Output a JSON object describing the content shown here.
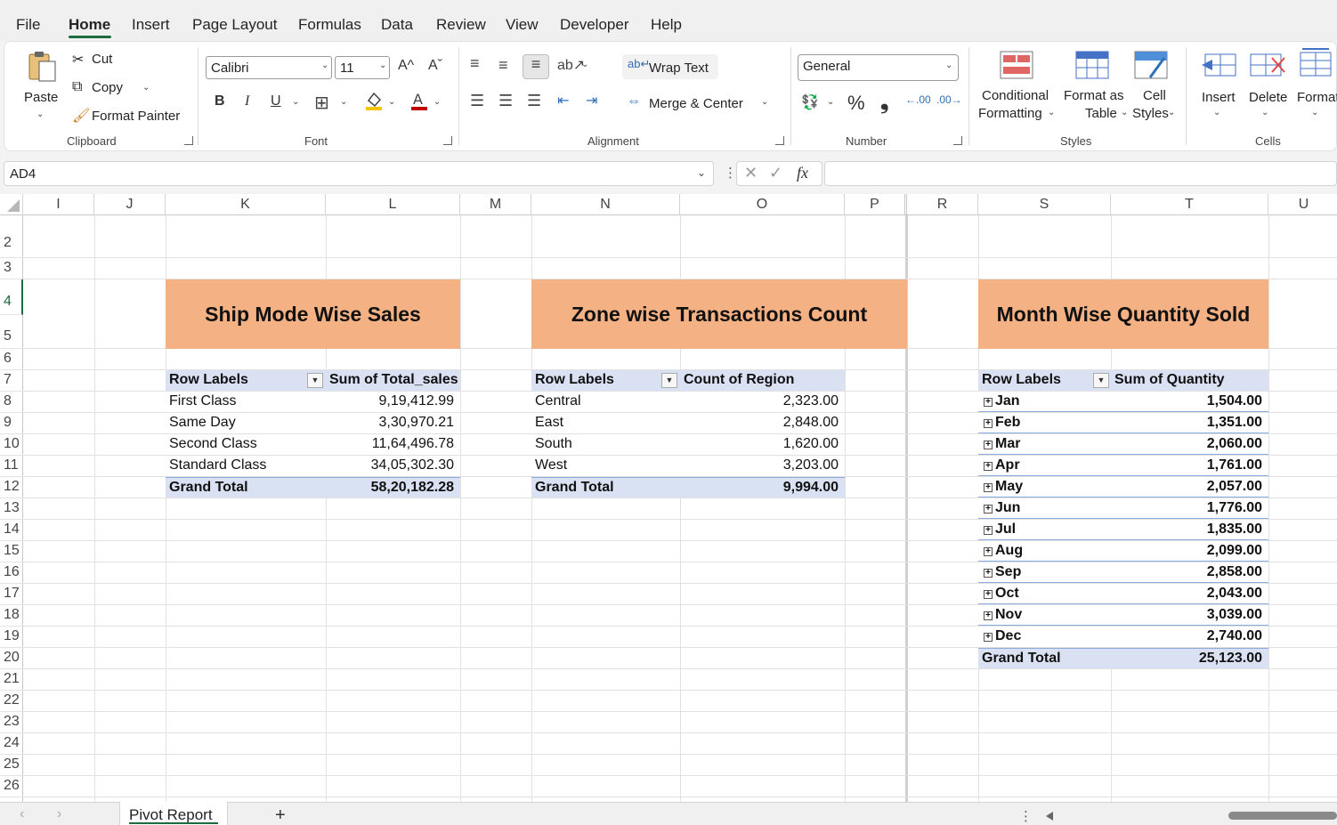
{
  "menu": [
    "File",
    "Home",
    "Insert",
    "Page Layout",
    "Formulas",
    "Data",
    "Review",
    "View",
    "Developer",
    "Help"
  ],
  "ribbon": {
    "clipboard": {
      "paste": "Paste",
      "cut": "Cut",
      "copy": "Copy",
      "format_painter": "Format Painter",
      "label": "Clipboard"
    },
    "font": {
      "name": "Calibri",
      "size": "11",
      "bold": "B",
      "italic": "I",
      "underline": "U",
      "grow": "A^",
      "shrink": "Aˇ",
      "label": "Font"
    },
    "alignment": {
      "wrap_text": "Wrap Text",
      "merge_center": "Merge & Center",
      "label": "Alignment"
    },
    "number": {
      "format": "General",
      "percent": "%",
      "comma": "❟",
      "label": "Number"
    },
    "styles": {
      "conditional_1": "Conditional",
      "conditional_2": "Formatting",
      "format_table_1": "Format as",
      "format_table_2": "Table",
      "cell_styles_1": "Cell",
      "cell_styles_2": "Styles",
      "label": "Styles"
    },
    "cells": {
      "insert": "Insert",
      "delete": "Delete",
      "format": "Format",
      "label": "Cells"
    }
  },
  "formula_bar": {
    "name_box": "AD4",
    "fx": "fx",
    "formula": ""
  },
  "columns": [
    "I",
    "J",
    "K",
    "L",
    "M",
    "N",
    "O",
    "P",
    "R",
    "S",
    "T",
    "U"
  ],
  "rows": [
    "2",
    "3",
    "4",
    "5",
    "6",
    "7",
    "8",
    "9",
    "10",
    "11",
    "12",
    "13",
    "14",
    "15",
    "16",
    "17",
    "18",
    "19",
    "20",
    "21",
    "22",
    "23",
    "24",
    "25",
    "26"
  ],
  "pivot1": {
    "title": "Ship Mode Wise Sales",
    "col1": "Row Labels",
    "col2": "Sum of Total_sales",
    "rows": [
      {
        "label": "First Class",
        "value": "9,19,412.99"
      },
      {
        "label": "Same Day",
        "value": "3,30,970.21"
      },
      {
        "label": "Second Class",
        "value": "11,64,496.78"
      },
      {
        "label": "Standard Class",
        "value": "34,05,302.30"
      }
    ],
    "total_label": "Grand Total",
    "total_value": "58,20,182.28"
  },
  "pivot2": {
    "title": "Zone wise Transactions Count",
    "col1": "Row Labels",
    "col2": "Count of Region",
    "rows": [
      {
        "label": "Central",
        "value": "2,323.00"
      },
      {
        "label": "East",
        "value": "2,848.00"
      },
      {
        "label": "South",
        "value": "1,620.00"
      },
      {
        "label": "West",
        "value": "3,203.00"
      }
    ],
    "total_label": "Grand Total",
    "total_value": "9,994.00"
  },
  "pivot3": {
    "title": "Month Wise Quantity Sold",
    "col1": "Row Labels",
    "col2": "Sum of Quantity",
    "rows": [
      {
        "label": "Jan",
        "value": "1,504.00"
      },
      {
        "label": "Feb",
        "value": "1,351.00"
      },
      {
        "label": "Mar",
        "value": "2,060.00"
      },
      {
        "label": "Apr",
        "value": "1,761.00"
      },
      {
        "label": "May",
        "value": "2,057.00"
      },
      {
        "label": "Jun",
        "value": "1,776.00"
      },
      {
        "label": "Jul",
        "value": "1,835.00"
      },
      {
        "label": "Aug",
        "value": "2,099.00"
      },
      {
        "label": "Sep",
        "value": "2,858.00"
      },
      {
        "label": "Oct",
        "value": "2,043.00"
      },
      {
        "label": "Nov",
        "value": "3,039.00"
      },
      {
        "label": "Dec",
        "value": "2,740.00"
      }
    ],
    "total_label": "Grand Total",
    "total_value": "25,123.00"
  },
  "sheet_tabs": {
    "active": "Pivot Report",
    "add": "+"
  },
  "colors": {
    "accent": "#1e6b40",
    "title_fill": "#f4b183",
    "pivot_header": "#d9e1f2"
  }
}
